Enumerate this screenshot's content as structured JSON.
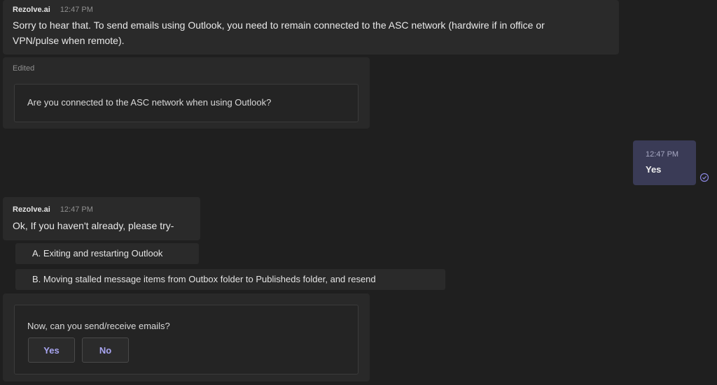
{
  "messages": {
    "bot1": {
      "sender": "Rezolve.ai",
      "time": "12:47 PM",
      "line1": "Sorry to hear that. To send emails using Outlook, you need to remain connected to the ASC network (hardwire if in office or",
      "line2": "VPN/pulse when remote).",
      "edited_label": "Edited",
      "card_question": "Are you connected to the ASC network when using Outlook?"
    },
    "user1": {
      "time": "12:47 PM",
      "text": "Yes",
      "status_icon": "read-receipt-icon"
    },
    "bot2": {
      "sender": "Rezolve.ai",
      "time": "12:47 PM",
      "text": "Ok, If you haven't already, please try-",
      "items": [
        "A. Exiting and restarting Outlook",
        "B. Moving stalled message items from Outbox folder to Publisheds folder, and resend"
      ],
      "card_question": "Now, can you send/receive emails?",
      "yes_label": "Yes",
      "no_label": "No"
    }
  },
  "colors": {
    "background": "#1f1f1f",
    "bubble": "#2a2a2a",
    "user_bubble": "#3a3b56",
    "accent": "#a9a6f2"
  }
}
